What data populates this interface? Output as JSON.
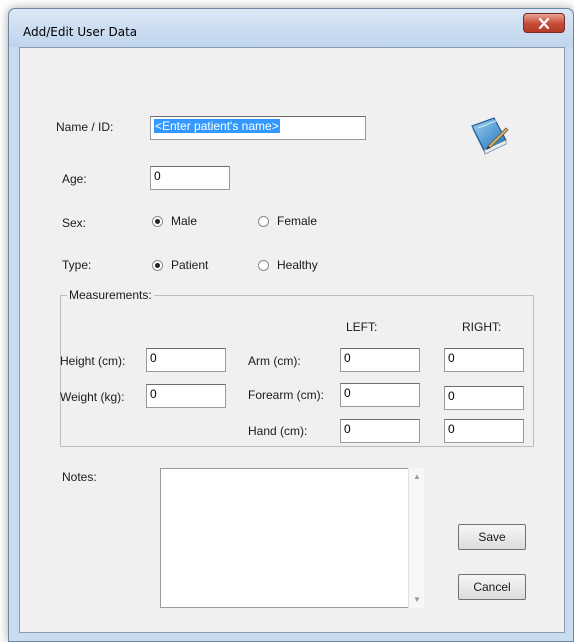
{
  "window": {
    "title": "Add/Edit User Data"
  },
  "form": {
    "name_label": "Name / ID:",
    "name_value": "<Enter patient's name>",
    "age_label": "Age:",
    "age_value": "0",
    "sex_label": "Sex:",
    "sex_options": [
      {
        "label": "Male",
        "selected": true
      },
      {
        "label": "Female",
        "selected": false
      }
    ],
    "type_label": "Type:",
    "type_options": [
      {
        "label": "Patient",
        "selected": true
      },
      {
        "label": "Healthy",
        "selected": false
      }
    ]
  },
  "measurements": {
    "title": "Measurements:",
    "left_header": "LEFT:",
    "right_header": "RIGHT:",
    "height_label": "Height (cm):",
    "height_value": "0",
    "weight_label": "Weight (kg):",
    "weight_value": "0",
    "arm_label": "Arm (cm):",
    "arm_left": "0",
    "arm_right": "0",
    "forearm_label": "Forearm (cm):",
    "forearm_left": "0",
    "forearm_right": "0",
    "hand_label": "Hand (cm):",
    "hand_left": "0",
    "hand_right": "0"
  },
  "notes": {
    "label": "Notes:",
    "value": ""
  },
  "buttons": {
    "save": "Save",
    "cancel": "Cancel"
  },
  "icons": {
    "app_icon": "book-pen-icon",
    "close": "close-icon"
  }
}
